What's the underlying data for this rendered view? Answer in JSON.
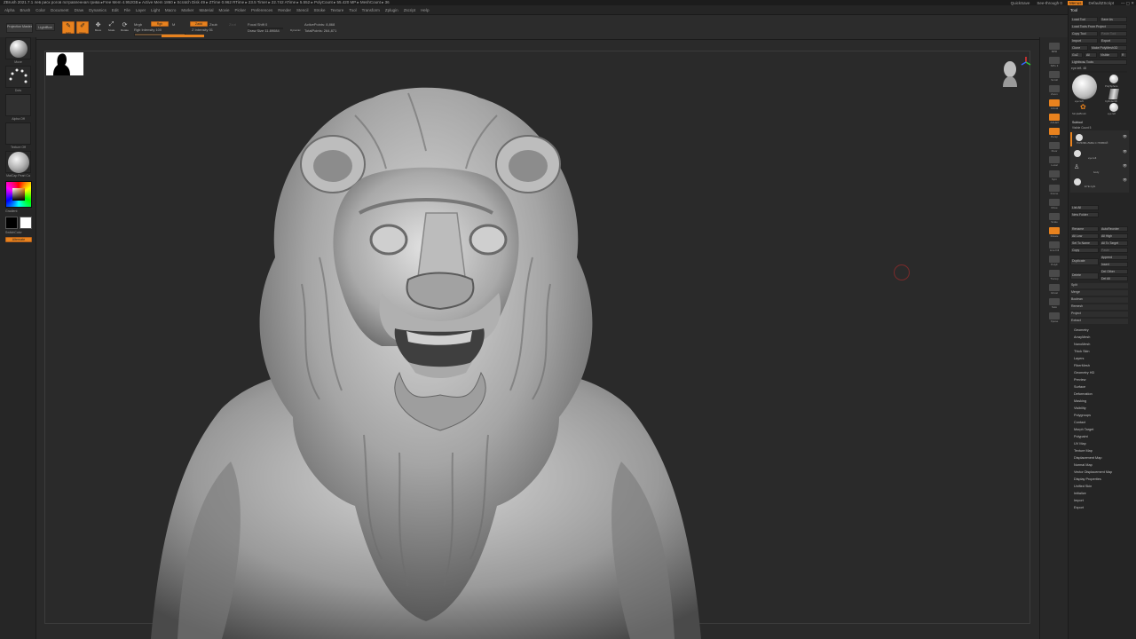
{
  "titlebar": {
    "title": "ZBrush 2021.7.1   лев риск рогов потравленная грива   ▸Free Mem 4.952GB ▸ Active Mem 1860 ▸ Scratch Disk 49 ▸ ZTime 0.962 RTime ▸ 23.5 Timer ▸ 22.742 ATime ▸ 5.552 ▸ PolyCount ▸ 55.420 MP ▸ MeshCount ▸ 36",
    "quicksave": "QuickSave",
    "see_through": "See-through 0",
    "menus_btn": "Menus",
    "script": "DefaultZScript"
  },
  "menubar": [
    "Alpha",
    "Brush",
    "Color",
    "Document",
    "Draw",
    "Dynamics",
    "Edit",
    "File",
    "Layer",
    "Light",
    "Macro",
    "Marker",
    "Material",
    "Movie",
    "Picker",
    "Preferences",
    "Render",
    "Stencil",
    "Stroke",
    "Texture",
    "Tool",
    "Transform",
    "Zplugin",
    "Zscript",
    "Help"
  ],
  "shelf": {
    "projection_master": "Projection Master",
    "lightbox": "LightBox",
    "edit": "Edit",
    "draw": "Draw",
    "move": "Move",
    "scale": "Scale",
    "rotate": "Rotate",
    "mrgb": "Mrgb",
    "rgb": "Rgb",
    "m": "M",
    "rgb_intensity": "Rgb Intensity 100",
    "zadd": "Zadd",
    "zsub": "Zsub",
    "zcut": "Zcut",
    "z_intensity": "Z Intensity 51",
    "focal_shift": "Focal Shift 0",
    "draw_size": "Draw Size 11.89084",
    "dynamic": "Dynamic",
    "active_points": "ActivePoints: 8,868",
    "total_points": "TotalPoints: 264,871"
  },
  "left": {
    "brush": "Move",
    "stroke": "Dots",
    "alpha": "Alpha Off",
    "texture": "Texture Off",
    "material": "MatCap Pearl Ca",
    "gradient": "Gradient",
    "switch_color": "SwitchColor",
    "alternate": "Alternate"
  },
  "rightshelf": [
    "BPR",
    "SPix 3",
    "Scroll",
    "Zoom",
    "Actual",
    "AAHalf",
    "Persp",
    "Floor",
    "Local",
    "Sym",
    "Frame",
    "Move",
    "Scale",
    "Rotate",
    "Line Fill",
    "PolyF",
    "Transp",
    "Ghost",
    "Solo",
    "Xpose"
  ],
  "tool": {
    "header": "Tool",
    "load_tool": "Load Tool",
    "save_as": "Save As",
    "load_tools_project": "Load Tools From Project",
    "copy_tool": "Copy Tool",
    "paste_tool": "Paste Tool",
    "import": "Import",
    "export": "Export",
    "clone": "Clone",
    "make_polymesh": "Make PolyMesh3D",
    "goz": "GoZ",
    "all": "All",
    "visible": "Visible",
    "r": "R",
    "lightbox_tools": "Lightbox▸ Tools",
    "current_tool": "eye left. 48",
    "thumbs": [
      "eye left",
      "PolySphere",
      "Cylinder3D",
      "SimpleBrush",
      "eye left"
    ],
    "subtool_header": "Subtool",
    "visible_count": "Visible Count 5",
    "subtools": [
      "ГОЛОВА ЛЬВА С ГРИВОЙ",
      "eye left",
      "body",
      "EYE right"
    ],
    "list_all": "List All",
    "new_folder": "New Folder",
    "rename": "Rename",
    "autoreorder": "AutoReorder",
    "all_low": "All Low",
    "all_high": "All High",
    "sel_to_name": "Sel To Name",
    "all_to_target": "All To Target",
    "copy": "Copy",
    "paste": "Paste",
    "duplicate": "Duplicate",
    "append": "Append",
    "insert": "Insert",
    "delete": "Delete",
    "del_other": "Del Other",
    "del_all": "Del All",
    "split": "Split",
    "merge": "Merge",
    "boolean": "Boolean",
    "remesh": "Remesh",
    "project": "Project",
    "extract": "Extract",
    "sections": [
      "Geometry",
      "ArrayMesh",
      "NanoMesh",
      "Thick Skin",
      "Layers",
      "FiberMesh",
      "Geometry HD",
      "Preview",
      "Surface",
      "Deformation",
      "Masking",
      "Visibility",
      "Polygroups",
      "Contact",
      "Morph Target",
      "Polypaint",
      "UV Map",
      "Texture Map",
      "Displacement Map",
      "Normal Map",
      "Vector Displacement Map",
      "Display Properties",
      "Unified Skin",
      "Initialize",
      "Import",
      "Export"
    ]
  },
  "colors": {
    "accent": "#e8821e",
    "panel": "#252525",
    "canvas": "#2a2a2a"
  }
}
